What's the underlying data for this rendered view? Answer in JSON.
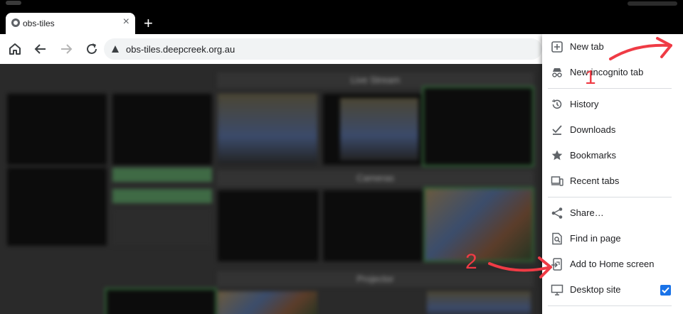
{
  "browser": {
    "tab": {
      "title": "obs-tiles",
      "close_glyph": "×"
    },
    "new_tab_glyph": "+",
    "url": "obs-tiles.deepcreek.org.au"
  },
  "page_sections": [
    "Live Stream",
    "Cameras",
    "Projector"
  ],
  "menu": {
    "items": [
      {
        "label": "New tab",
        "icon": "plus-box-icon"
      },
      {
        "label": "New incognito tab",
        "icon": "incognito-icon"
      },
      {
        "label": "History",
        "icon": "history-icon"
      },
      {
        "label": "Downloads",
        "icon": "download-check-icon"
      },
      {
        "label": "Bookmarks",
        "icon": "star-icon"
      },
      {
        "label": "Recent tabs",
        "icon": "devices-icon"
      },
      {
        "label": "Share…",
        "icon": "share-icon"
      },
      {
        "label": "Find in page",
        "icon": "find-in-page-icon"
      },
      {
        "label": "Add to Home screen",
        "icon": "add-to-home-icon"
      },
      {
        "label": "Desktop site",
        "icon": "desktop-icon",
        "checked": true
      }
    ]
  },
  "annotations": {
    "step1": "1",
    "step2": "2",
    "color": "#ef3b45"
  },
  "colors": {
    "accent": "#1a73e8",
    "tile_border": "#2f5f35"
  }
}
